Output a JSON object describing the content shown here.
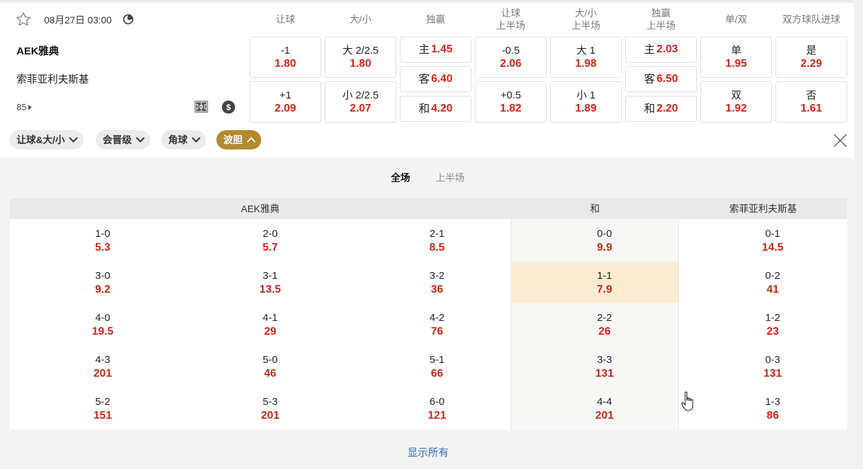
{
  "match": {
    "date": "08月27日 03:00",
    "home_team": "AEK雅典",
    "away_team": "索菲亚利夫斯基",
    "minute": "85"
  },
  "columns": [
    "让球",
    "大/小",
    "独赢",
    "让球\n上半场",
    "大/小\n上半场",
    "独赢\n上半场",
    "单/双",
    "双方球队进球"
  ],
  "odds": {
    "handicap": [
      {
        "label": "-1",
        "value": "1.80"
      },
      {
        "label": "+1",
        "value": "2.09"
      }
    ],
    "over_under": [
      {
        "label": "大 2/2.5",
        "value": "1.80"
      },
      {
        "label": "小 2/2.5",
        "value": "2.07"
      }
    ],
    "moneyline": [
      {
        "label": "主",
        "value": "1.45"
      },
      {
        "label": "客",
        "value": "6.40"
      },
      {
        "label": "和",
        "value": "4.20"
      }
    ],
    "handicap_1h": [
      {
        "label": "-0.5",
        "value": "2.06"
      },
      {
        "label": "+0.5",
        "value": "1.82"
      }
    ],
    "over_under_1h": [
      {
        "label": "大 1",
        "value": "1.98"
      },
      {
        "label": "小 1",
        "value": "1.89"
      }
    ],
    "moneyline_1h": [
      {
        "label": "主",
        "value": "2.03"
      },
      {
        "label": "客",
        "value": "6.50"
      },
      {
        "label": "和",
        "value": "2.20"
      }
    ],
    "odd_even": [
      {
        "label": "单",
        "value": "1.95"
      },
      {
        "label": "双",
        "value": "1.92"
      }
    ],
    "both_score": [
      {
        "label": "是",
        "value": "2.29"
      },
      {
        "label": "否",
        "value": "1.61"
      }
    ]
  },
  "market_tabs": [
    {
      "label": "让球&大/小"
    },
    {
      "label": "会晋级"
    },
    {
      "label": "角球"
    },
    {
      "label": "波胆"
    }
  ],
  "period_tabs": {
    "full": "全场",
    "half": "上半场"
  },
  "correct_score": {
    "home_header": "AEK雅典",
    "draw_header": "和",
    "away_header": "索菲亚利夫斯基",
    "home": [
      [
        {
          "s": "1-0",
          "p": "5.3"
        },
        {
          "s": "2-0",
          "p": "5.7"
        },
        {
          "s": "2-1",
          "p": "8.5"
        }
      ],
      [
        {
          "s": "3-0",
          "p": "9.2"
        },
        {
          "s": "3-1",
          "p": "13.5"
        },
        {
          "s": "3-2",
          "p": "36"
        }
      ],
      [
        {
          "s": "4-0",
          "p": "19.5"
        },
        {
          "s": "4-1",
          "p": "29"
        },
        {
          "s": "4-2",
          "p": "76"
        }
      ],
      [
        {
          "s": "4-3",
          "p": "201"
        },
        {
          "s": "5-0",
          "p": "46"
        },
        {
          "s": "5-1",
          "p": "66"
        }
      ],
      [
        {
          "s": "5-2",
          "p": "151"
        },
        {
          "s": "5-3",
          "p": "201"
        },
        {
          "s": "6-0",
          "p": "121"
        }
      ]
    ],
    "draw": [
      {
        "s": "0-0",
        "p": "9.9"
      },
      {
        "s": "1-1",
        "p": "7.9"
      },
      {
        "s": "2-2",
        "p": "26"
      },
      {
        "s": "3-3",
        "p": "131"
      },
      {
        "s": "4-4",
        "p": "201"
      }
    ],
    "away": [
      {
        "s": "0-1",
        "p": "14.5"
      },
      {
        "s": "0-2",
        "p": "41"
      },
      {
        "s": "1-2",
        "p": "23"
      },
      {
        "s": "0-3",
        "p": "131"
      },
      {
        "s": "1-3",
        "p": "86"
      }
    ]
  },
  "show_all": "显示所有",
  "colors": {
    "accent": "#b38a2e",
    "odds_red": "#c8281a",
    "link_blue": "#2c6fb5",
    "highlight": "#fbecd1"
  }
}
